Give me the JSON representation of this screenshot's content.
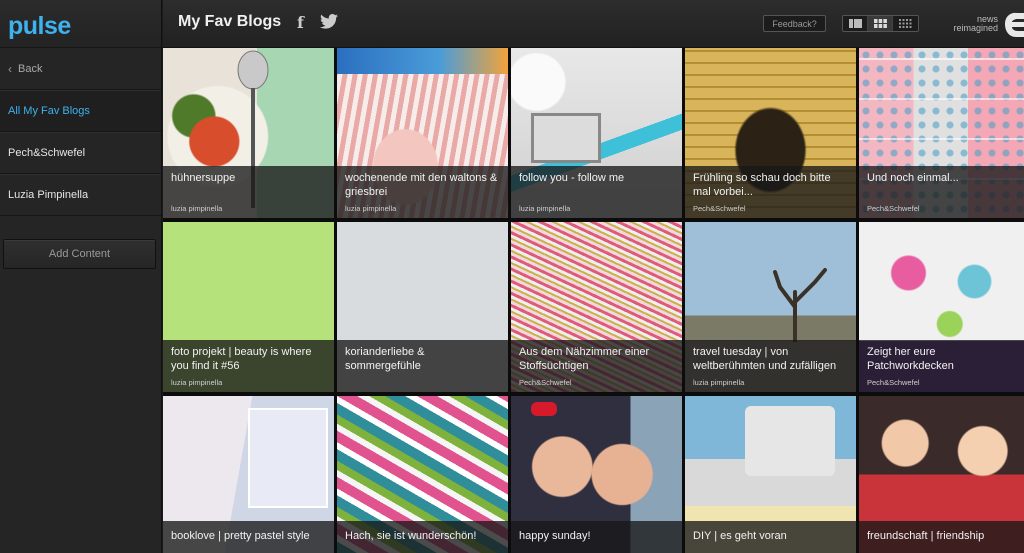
{
  "app": {
    "logo": "pulse"
  },
  "sidebar": {
    "back_label": "Back",
    "items": [
      {
        "label": "All My Fav Blogs",
        "active": true
      },
      {
        "label": "Pech&Schwefel",
        "active": false
      },
      {
        "label": "Luzia Pimpinella",
        "active": false
      }
    ],
    "add_content_label": "Add Content"
  },
  "header": {
    "title": "My Fav Blogs",
    "feedback_label": "Feedback?",
    "brand_line1": "news",
    "brand_line2": "reimagined",
    "social_icons": [
      "facebook-icon",
      "twitter-icon"
    ],
    "view_modes": [
      "list-view-icon",
      "grid-view-icon",
      "dense-grid-view-icon"
    ]
  },
  "colors": {
    "accent": "#3db2ef",
    "background": "#1b1b1b"
  },
  "tiles": [
    {
      "title": "hühnersuppe",
      "source": "luzia pimpinella"
    },
    {
      "title": "wochenende mit den waltons & griesbrei",
      "source": "luzia pimpinella"
    },
    {
      "title": "follow you - follow me",
      "source": "luzia pimpinella"
    },
    {
      "title": "Frühling so schau doch bitte mal vorbei...",
      "source": "Pech&Schwefel"
    },
    {
      "title": "Und noch einmal...",
      "source": "Pech&Schwefel"
    },
    {
      "title": "foto projekt | beauty is where you find it #56",
      "source": "luzia pimpinella"
    },
    {
      "title": "korianderliebe & sommergefühle",
      "source": ""
    },
    {
      "title": "Aus dem Nähzimmer einer Stoffsüchtigen",
      "source": "Pech&Schwefel"
    },
    {
      "title": "travel tuesday | von weltberühmten und zufälligen",
      "source": "luzia pimpinella"
    },
    {
      "title": "Zeigt her eure Patchworkdecken",
      "source": "Pech&Schwefel"
    },
    {
      "title": "booklove | pretty pastel style",
      "source": ""
    },
    {
      "title": "Hach, sie ist wunderschön!",
      "source": ""
    },
    {
      "title": "happy sunday!",
      "source": ""
    },
    {
      "title": "DIY | es geht voran",
      "source": ""
    },
    {
      "title": "freundschaft | friendship",
      "source": ""
    }
  ]
}
